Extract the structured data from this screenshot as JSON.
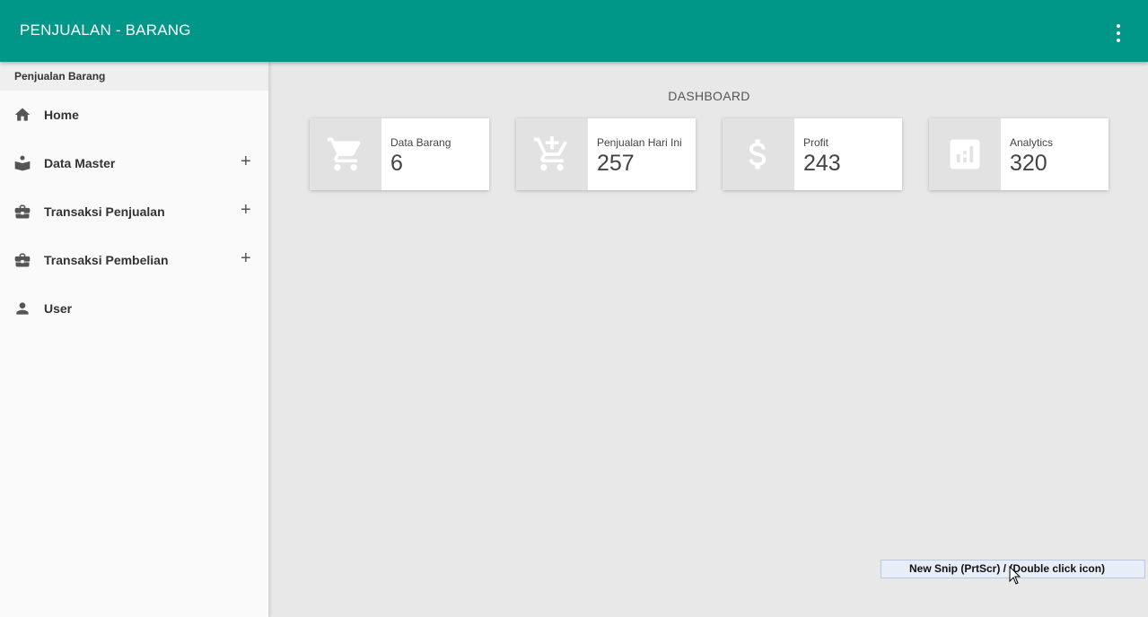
{
  "header": {
    "title": "PENJUALAN - BARANG",
    "menu_icon": "more-vert-icon"
  },
  "sidebar": {
    "title": "Penjualan Barang",
    "items": [
      {
        "label": "Home",
        "icon": "home-icon",
        "expandable": false
      },
      {
        "label": "Data Master",
        "icon": "book-icon",
        "expandable": true,
        "toggle": "+"
      },
      {
        "label": "Transaksi Penjualan",
        "icon": "briefcase-icon",
        "expandable": true,
        "toggle": "+"
      },
      {
        "label": "Transaksi Pembelian",
        "icon": "briefcase-icon",
        "expandable": true,
        "toggle": "+"
      },
      {
        "label": "User",
        "icon": "person-icon",
        "expandable": false
      }
    ]
  },
  "main": {
    "title": "DASHBOARD",
    "cards": [
      {
        "label": "Data Barang",
        "value": "6",
        "icon": "shopping-cart-icon"
      },
      {
        "label": "Penjualan Hari Ini",
        "value": "257",
        "icon": "add-shopping-cart-icon"
      },
      {
        "label": "Profit",
        "value": "243",
        "icon": "dollar-icon"
      },
      {
        "label": "Analytics",
        "value": "320",
        "icon": "analytics-icon"
      }
    ]
  },
  "tooltip": {
    "text": "New Snip (PrtScr) / (Double click icon)"
  },
  "colors": {
    "accent": "#009688",
    "sidebar_bg": "#fafafa",
    "main_bg": "#e8e8e8",
    "card_icon_bg": "#e2e2e2"
  }
}
